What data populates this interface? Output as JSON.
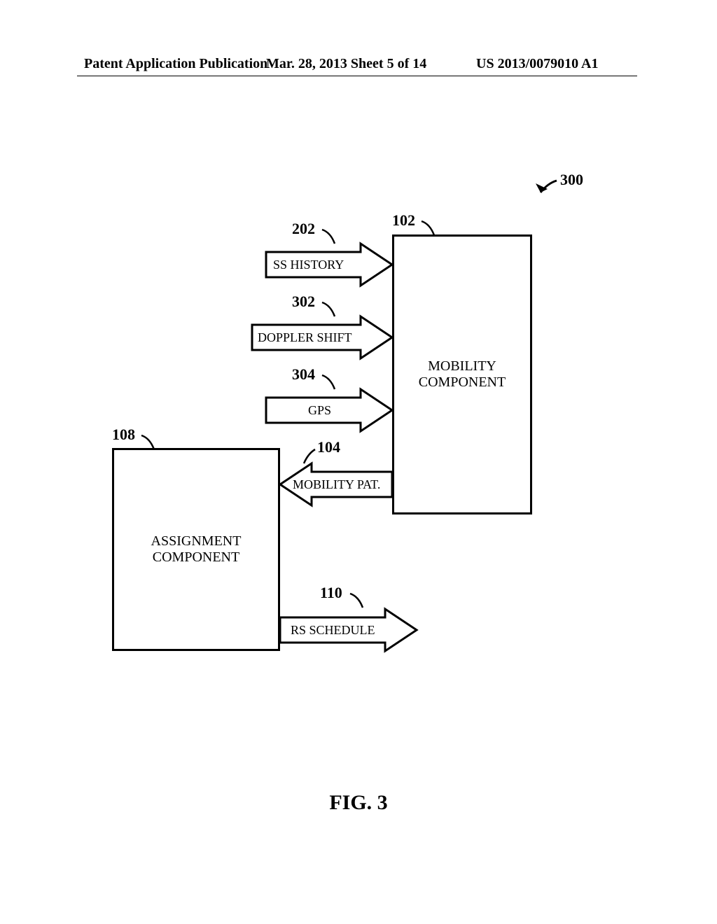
{
  "header": {
    "left": "Patent Application Publication",
    "center": "Mar. 28, 2013  Sheet 5 of 14",
    "right": "US 2013/0079010 A1"
  },
  "figure": {
    "caption": "FIG. 3",
    "overall_ref": "300"
  },
  "boxes": {
    "mobility": {
      "label": "MOBILITY\nCOMPONENT",
      "ref": "102"
    },
    "assignment": {
      "label": "ASSIGNMENT\nCOMPONENT",
      "ref": "108"
    }
  },
  "arrows": {
    "ss_history": {
      "label": "SS HISTORY",
      "ref": "202"
    },
    "doppler": {
      "label": "DOPPLER SHIFT",
      "ref": "302"
    },
    "gps": {
      "label": "GPS",
      "ref": "304"
    },
    "mobility_pat": {
      "label": "MOBILITY PAT.",
      "ref": "104"
    },
    "rs_schedule": {
      "label": "RS SCHEDULE",
      "ref": "110"
    }
  }
}
